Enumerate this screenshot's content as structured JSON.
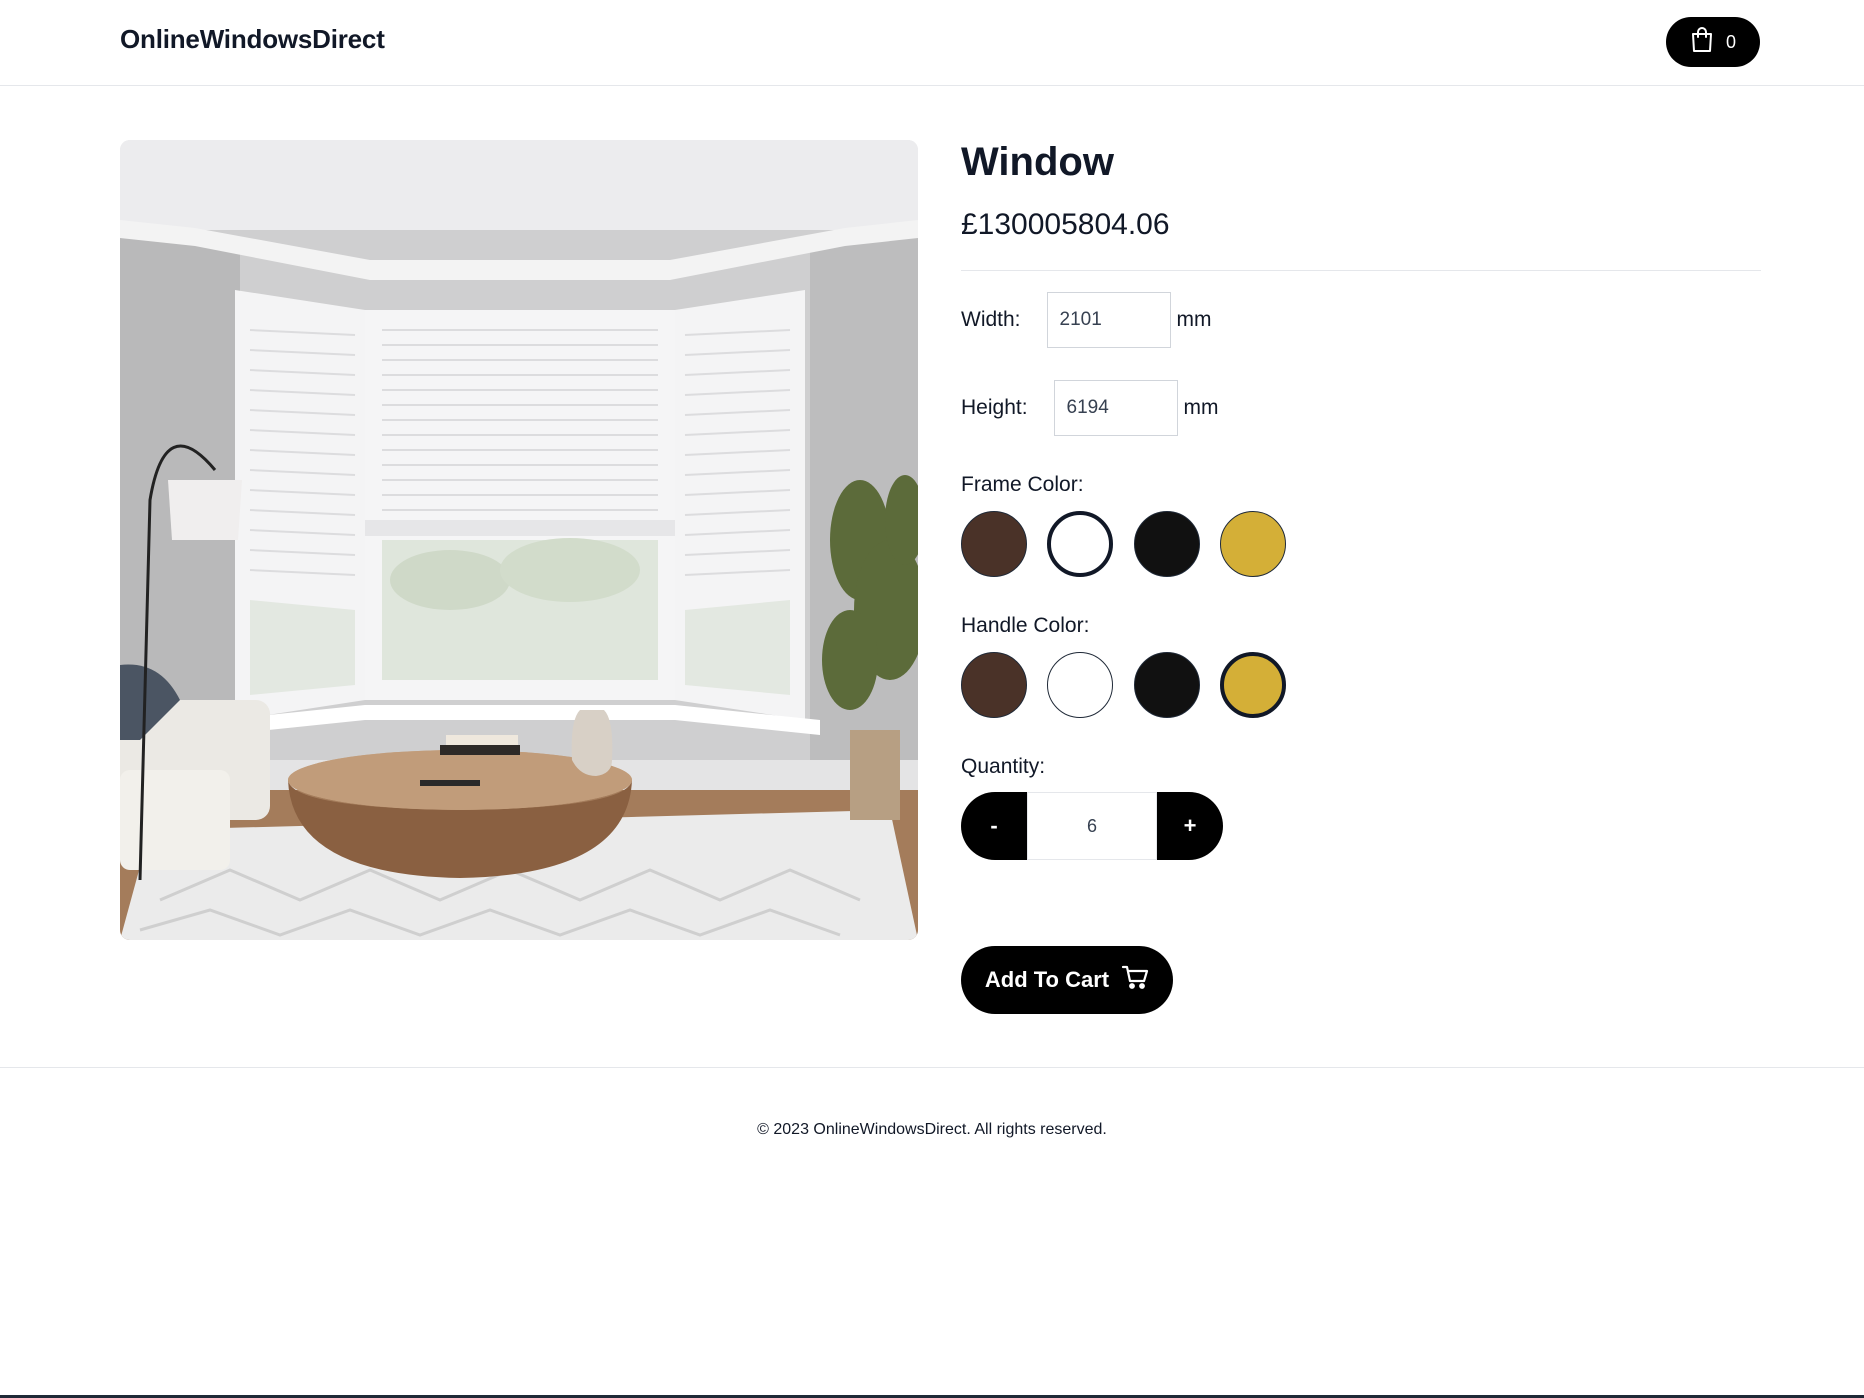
{
  "header": {
    "brand": "OnlineWindowsDirect",
    "cart_icon": "shopping-bag-icon",
    "cart_count": "0"
  },
  "product": {
    "image_icon": "product-photo",
    "title": "Window",
    "price": "£130005804.06"
  },
  "dimensions": {
    "width_label": "Width:",
    "width_value": "2101",
    "height_label": "Height:",
    "height_value": "6194",
    "unit": "mm"
  },
  "frame_color": {
    "label": "Frame Color:",
    "options": [
      {
        "color": "#4a3228",
        "selected": false
      },
      {
        "color": "#ffffff",
        "selected": true
      },
      {
        "color": "#111111",
        "selected": false
      },
      {
        "color": "#d4af37",
        "selected": false
      }
    ]
  },
  "handle_color": {
    "label": "Handle Color:",
    "options": [
      {
        "color": "#4a3228",
        "selected": false
      },
      {
        "color": "#ffffff",
        "selected": false
      },
      {
        "color": "#111111",
        "selected": false
      },
      {
        "color": "#d4af37",
        "selected": true
      }
    ]
  },
  "quantity": {
    "label": "Quantity:",
    "minus": "-",
    "value": "6",
    "plus": "+"
  },
  "actions": {
    "add_to_cart": "Add To Cart",
    "add_to_cart_icon": "cart-icon"
  },
  "footer": {
    "copyright": "© 2023 OnlineWindowsDirect. All rights reserved."
  }
}
